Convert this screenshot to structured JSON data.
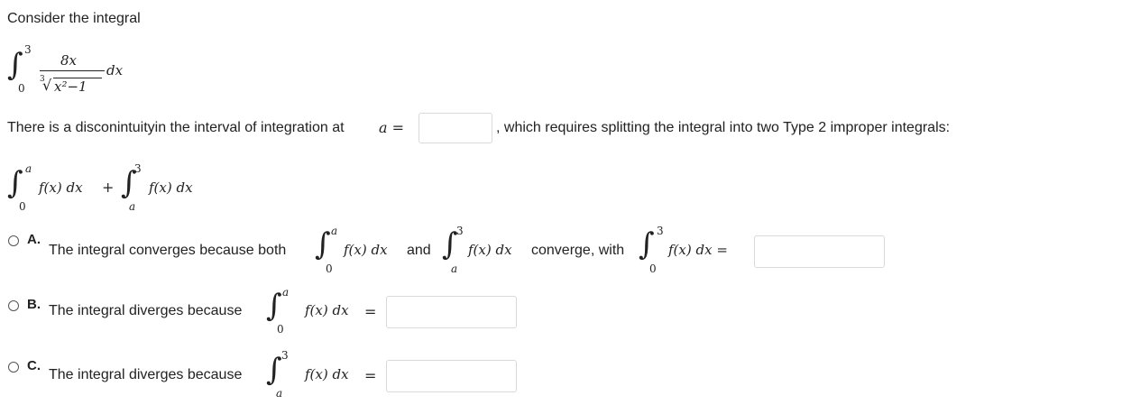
{
  "intro": {
    "text": "Consider the integral",
    "integral": {
      "upper": "3",
      "lower": "0",
      "numerator": "8x",
      "radical_index": "3",
      "radicand": "x²−1",
      "dx": "dx"
    }
  },
  "discontinuity": {
    "before": "There is a disconintuityin the interval of integration at ",
    "var_eq": "a =",
    "answer_value": "",
    "after": ", which requires splitting the integral into two Type 2 improper integrals:"
  },
  "split": {
    "int1": {
      "upper": "a",
      "lower": "0",
      "body": "f(x) dx"
    },
    "plus": "+",
    "int2": {
      "upper": "3",
      "lower": "a",
      "body": "f(x) dx"
    }
  },
  "options": [
    {
      "letter": "A.",
      "text1": "The integral converges because both",
      "int1": {
        "upper": "a",
        "lower": "0",
        "body": "f(x) dx"
      },
      "and": "and",
      "int2": {
        "upper": "3",
        "lower": "a",
        "body": "f(x) dx"
      },
      "text2": "converge, with",
      "int3": {
        "upper": "3",
        "lower": "0",
        "body": "f(x) dx ="
      },
      "answer_value": ""
    },
    {
      "letter": "B.",
      "text": "The integral diverges because",
      "int": {
        "upper": "a",
        "lower": "0",
        "body": "f(x) dx"
      },
      "eq": "=",
      "answer_value": ""
    },
    {
      "letter": "C.",
      "text": "The integral diverges because",
      "int": {
        "upper": "3",
        "lower": "a",
        "body": "f(x) dx"
      },
      "eq": "=",
      "answer_value": ""
    }
  ]
}
